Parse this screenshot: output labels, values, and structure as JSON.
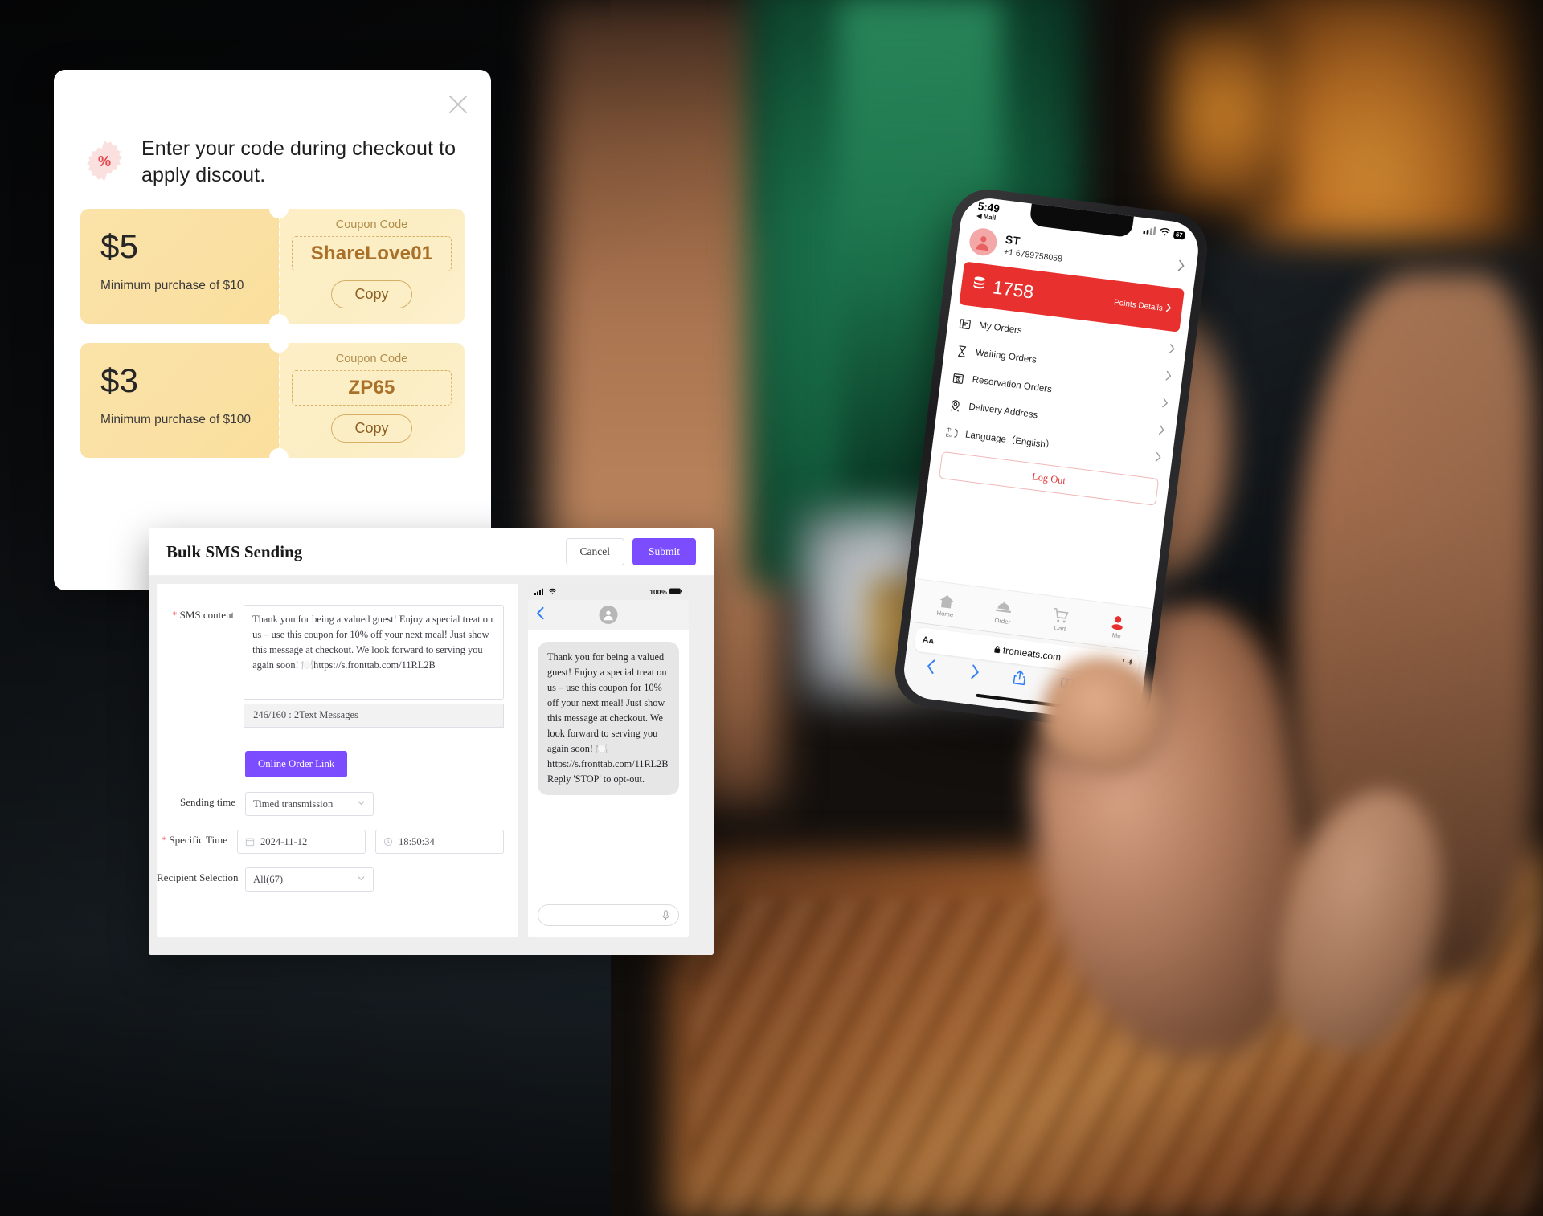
{
  "coupon_modal": {
    "close_icon": "close-icon",
    "badge_icon": "percent-badge-icon",
    "headline": "Enter your code during checkout to apply discout.",
    "coupons": [
      {
        "amount": "$5",
        "minimum": "Minimum purchase of $10",
        "code_label": "Coupon Code",
        "code": "ShareLove01",
        "copy_label": "Copy"
      },
      {
        "amount": "$3",
        "minimum": "Minimum purchase of $100",
        "code_label": "Coupon Code",
        "code": "ZP65",
        "copy_label": "Copy"
      }
    ]
  },
  "sms_dialog": {
    "title": "Bulk SMS Sending",
    "cancel_label": "Cancel",
    "submit_label": "Submit",
    "form": {
      "sms_content_label": "SMS content",
      "sms_content_value": "Thank you for being a valued guest! Enjoy a special treat on us – use this coupon for 10% off your next meal! Just show this message at checkout. We look forward to serving you again soon! 🍽️https://s.fronttab.com/11RL2B",
      "character_count": "246/160 : 2Text Messages",
      "online_order_link_label": "Online Order Link",
      "sending_time_label": "Sending time",
      "sending_time_value": "Timed transmission",
      "specific_time_label": "Specific Time",
      "specific_date_value": "2024-11-12",
      "specific_clock_value": "18:50:34",
      "recipient_selection_label": "Recipient Selection",
      "recipient_selection_value": "All(67)",
      "date_icon": "calendar-icon",
      "clock_icon": "clock-icon",
      "caret_icon": "chevron-down-icon"
    },
    "preview": {
      "signal_icon": "cellular-signal-icon",
      "wifi_icon": "wifi-icon",
      "battery_text": "100%",
      "battery_icon": "battery-full-icon",
      "back_icon": "chevron-left-icon",
      "avatar_icon": "person-avatar-icon",
      "message": "Thank you for being a valued guest! Enjoy a special treat on us – use this coupon for 10% off your next meal! Just show this message at checkout. We look forward to serving you again soon! 🍽️ https://s.fronttab.com/11RL2B Reply 'STOP' to opt-out.",
      "input_placeholder": "",
      "mic_icon": "microphone-icon"
    }
  },
  "iphone": {
    "status": {
      "time": "5:49",
      "back_app": "◀ Mail",
      "signal_icon": "cellular-signal-icon",
      "wifi_icon": "wifi-icon",
      "battery": "57"
    },
    "profile": {
      "avatar_icon": "user-avatar-icon",
      "name": "ST",
      "phone": "+1 6789758058",
      "chevron_icon": "chevron-right-icon"
    },
    "points": {
      "coins_icon": "coins-stack-icon",
      "value": "1758",
      "details_label": "Points Details",
      "chevron_icon": "chevron-right-icon"
    },
    "menu": [
      {
        "label": "My Orders",
        "icon": "order-list-icon"
      },
      {
        "label": "Waiting Orders",
        "icon": "hourglass-icon"
      },
      {
        "label": "Reservation Orders",
        "icon": "reservation-clock-icon"
      },
      {
        "label": "Delivery Address",
        "icon": "map-pin-icon"
      },
      {
        "label": "Language（English）",
        "icon": "language-icon"
      }
    ],
    "logout_label": "Log Out",
    "tabbar": [
      {
        "label": "Home",
        "icon": "home-icon",
        "active": false
      },
      {
        "label": "Order",
        "icon": "food-cover-icon",
        "active": false
      },
      {
        "label": "Cart",
        "icon": "shopping-cart-icon",
        "active": false
      },
      {
        "label": "Me",
        "icon": "person-icon",
        "active": true
      }
    ],
    "safari": {
      "aa_label": "Aᴀ",
      "lock_icon": "lock-icon",
      "url": "fronteats.com",
      "reload_icon": "reload-icon",
      "back_icon": "chevron-left-icon",
      "forward_icon": "chevron-right-icon",
      "share_icon": "share-icon",
      "bookmarks_icon": "book-icon",
      "tabs_icon": "tabs-icon"
    }
  },
  "colors": {
    "accent_purple": "#7c4dff",
    "brand_red": "#e8312e",
    "coupon_gold": "#a9702a",
    "coupon_bg": "#fbe2a8",
    "safari_blue": "#2f7cf6"
  }
}
